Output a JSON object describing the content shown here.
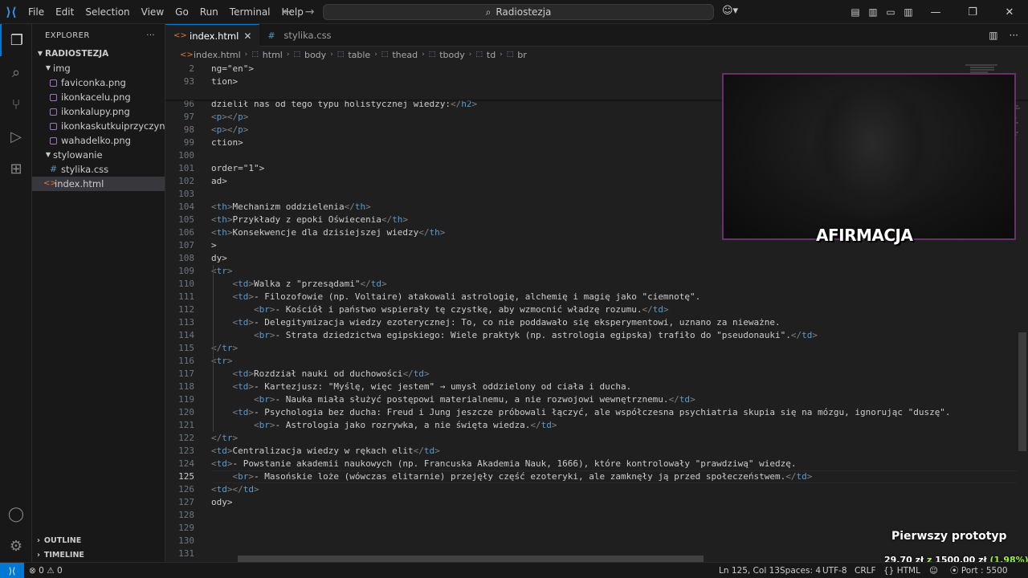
{
  "menu": [
    "File",
    "Edit",
    "Selection",
    "View",
    "Go",
    "Run",
    "Terminal",
    "Help"
  ],
  "command_center": "Radiostezja",
  "sidebar": {
    "title": "EXPLORER",
    "root": "RADIOSTEZJA",
    "folder_img": "img",
    "files_img": [
      "faviconka.png",
      "ikonkacelu.png",
      "ikonkalupy.png",
      "ikonkaskutkuiprzyczyny.p...",
      "wahadelko.png"
    ],
    "folder_styl": "stylowanie",
    "file_css": "stylika.css",
    "file_html": "index.html",
    "outline": "OUTLINE",
    "timeline": "TIMELINE"
  },
  "tabs": [
    {
      "label": "index.html"
    },
    {
      "label": "stylika.css"
    }
  ],
  "breadcrumb": [
    "index.html",
    "html",
    "body",
    "table",
    "thead",
    "tbody",
    "td",
    "br"
  ],
  "sticky": [
    {
      "ln": "2",
      "text": "ng=\"en\">"
    },
    {
      "ln": "93",
      "text": "tion>"
    }
  ],
  "lines": [
    {
      "ln": "96",
      "text": "dzielił nas od tego typu holistycznej wiedzy:</h2>"
    },
    {
      "ln": "97",
      "text": "<p></p>"
    },
    {
      "ln": "98",
      "text": "<p></p>"
    },
    {
      "ln": "99",
      "text": "ction>"
    },
    {
      "ln": "100",
      "text": ""
    },
    {
      "ln": "101",
      "text": "order=\"1\">"
    },
    {
      "ln": "102",
      "text": "ad>"
    },
    {
      "ln": "103",
      "text": ""
    },
    {
      "ln": "104",
      "text": "<th>Mechanizm oddzielenia</th>"
    },
    {
      "ln": "105",
      "text": "<th>Przykłady z epoki Oświecenia</th>"
    },
    {
      "ln": "106",
      "text": "<th>Konsekwencje dla dzisiejszej wiedzy</th>"
    },
    {
      "ln": "107",
      "text": ">"
    },
    {
      "ln": "108",
      "text": "dy>"
    },
    {
      "ln": "109",
      "text": "<tr>"
    },
    {
      "ln": "110",
      "text": "    <td>Walka z \"przesądami\"</td>"
    },
    {
      "ln": "111",
      "text": "    <td>- Filozofowie (np. Voltaire) atakowali astrologię, alchemię i magię jako \"ciemnotę\"."
    },
    {
      "ln": "112",
      "text": "        <br>- Kościół i państwo wspierały tę czystkę, aby wzmocnić władzę rozumu.</td>"
    },
    {
      "ln": "113",
      "text": "    <td>- Delegitymizacja wiedzy ezoterycznej: To, co nie poddawało się eksperymentowi, uznano za nieważne."
    },
    {
      "ln": "114",
      "text": "        <br>- Strata dziedzictwa egipskiego: Wiele praktyk (np. astrologia egipska) trafiło do \"pseudonauki\".</td>"
    },
    {
      "ln": "115",
      "text": "</tr>"
    },
    {
      "ln": "116",
      "text": "<tr>"
    },
    {
      "ln": "117",
      "text": "    <td>Rozdział nauki od duchowości</td>"
    },
    {
      "ln": "118",
      "text": "    <td>- Kartezjusz: \"Myślę, więc jestem\" → umysł oddzielony od ciała i ducha."
    },
    {
      "ln": "119",
      "text": "        <br>- Nauka miała służyć postępowi materialnemu, a nie rozwojowi wewnętrznemu.</td>"
    },
    {
      "ln": "120",
      "text": "    <td>- Psychologia bez ducha: Freud i Jung jeszcze próbowali łączyć, ale współczesna psychiatria skupia się na mózgu, ignorując \"duszę\"."
    },
    {
      "ln": "121",
      "text": "        <br>- Astrologia jako rozrywka, a nie święta wiedza.</td>"
    },
    {
      "ln": "122",
      "text": "</tr>"
    },
    {
      "ln": "123",
      "text": "<td>Centralizacja wiedzy w rękach elit</td>"
    },
    {
      "ln": "124",
      "text": "<td>- Powstanie akademii naukowych (np. Francuska Akademia Nauk, 1666), które kontrolowały \"prawdziwą\" wiedzę."
    },
    {
      "ln": "125",
      "text": "    <br>- Masońskie loże (wówczas elitarnie) przejęły część ezoteryki, ale zamknęły ją przed społeczeństwem.</td>"
    },
    {
      "ln": "126",
      "text": "<td></td>"
    },
    {
      "ln": "127",
      "text": "ody>"
    },
    {
      "ln": "128",
      "text": ""
    },
    {
      "ln": "129",
      "text": ""
    },
    {
      "ln": "130",
      "text": ""
    },
    {
      "ln": "131",
      "text": ""
    }
  ],
  "current_line": "125",
  "webcam_label": "AFIRMACJA",
  "overlay": {
    "title": "Pierwszy prototyp",
    "amount": "29,70 zł",
    "of": "z",
    "goal": "1500,00 zł",
    "percent": "(1.98%)"
  },
  "status": {
    "errors": "0",
    "warnings": "0",
    "position": "Ln 125, Col 13",
    "spaces": "Spaces: 4",
    "encoding": "UTF-8",
    "eol": "CRLF",
    "language": "HTML",
    "port": "Port : 5500"
  },
  "colors": {
    "accent": "#0078d4",
    "webcam_border": "#6b2f6e",
    "donation_green": "#9bef3a"
  }
}
